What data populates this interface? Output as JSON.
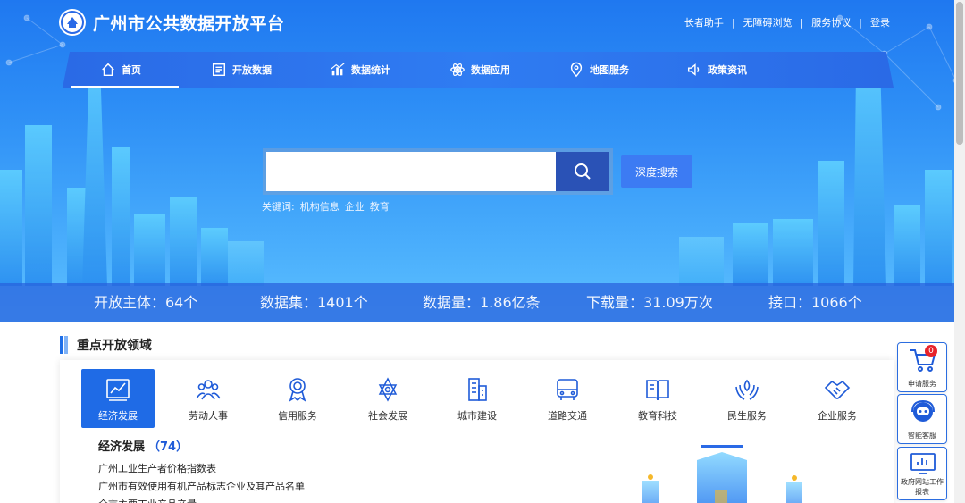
{
  "header": {
    "title": "广州市公共数据开放平台",
    "links": [
      "长者助手",
      "无障碍浏览",
      "服务协议",
      "登录"
    ]
  },
  "nav": [
    {
      "label": "首页",
      "icon": "home-icon"
    },
    {
      "label": "开放数据",
      "icon": "data-icon"
    },
    {
      "label": "数据统计",
      "icon": "chart-icon"
    },
    {
      "label": "数据应用",
      "icon": "atom-icon"
    },
    {
      "label": "地图服务",
      "icon": "map-pin-icon"
    },
    {
      "label": "政策资讯",
      "icon": "speaker-icon"
    }
  ],
  "search": {
    "value": "",
    "deep_label": "深度搜索",
    "keywords_label": "关键词:",
    "keywords": [
      "机构信息",
      "企业",
      "教育"
    ]
  },
  "stats": [
    "开放主体：64个",
    "数据集：1401个",
    "数据量：1.86亿条",
    "下载量：31.09万次",
    "接口：1066个"
  ],
  "section": {
    "title": "重点开放领域",
    "categories": [
      {
        "label": "经济发展",
        "icon": "trend-chart-icon"
      },
      {
        "label": "劳动人事",
        "icon": "people-icon"
      },
      {
        "label": "信用服务",
        "icon": "medal-icon"
      },
      {
        "label": "社会发展",
        "icon": "star-network-icon"
      },
      {
        "label": "城市建设",
        "icon": "building-icon"
      },
      {
        "label": "道路交通",
        "icon": "bus-icon"
      },
      {
        "label": "教育科技",
        "icon": "book-icon"
      },
      {
        "label": "民生服务",
        "icon": "hands-icon"
      },
      {
        "label": "企业服务",
        "icon": "handshake-icon"
      }
    ],
    "detail_title": "经济发展",
    "detail_count": "（74）",
    "detail_items": [
      "广州工业生产者价格指数表",
      "广州市有效使用有机产品标志企业及其产品名单",
      "全市主要工业产品产量"
    ]
  },
  "sidetools": [
    {
      "label": "申请服务",
      "icon": "cart-icon",
      "badge": "0"
    },
    {
      "label": "智能客服",
      "icon": "robot-icon"
    },
    {
      "label": "政府网站工作报表",
      "icon": "report-icon"
    }
  ],
  "colors": {
    "primary": "#1f6be6",
    "nav": "#2f7cf2",
    "badge": "#e7232b"
  }
}
